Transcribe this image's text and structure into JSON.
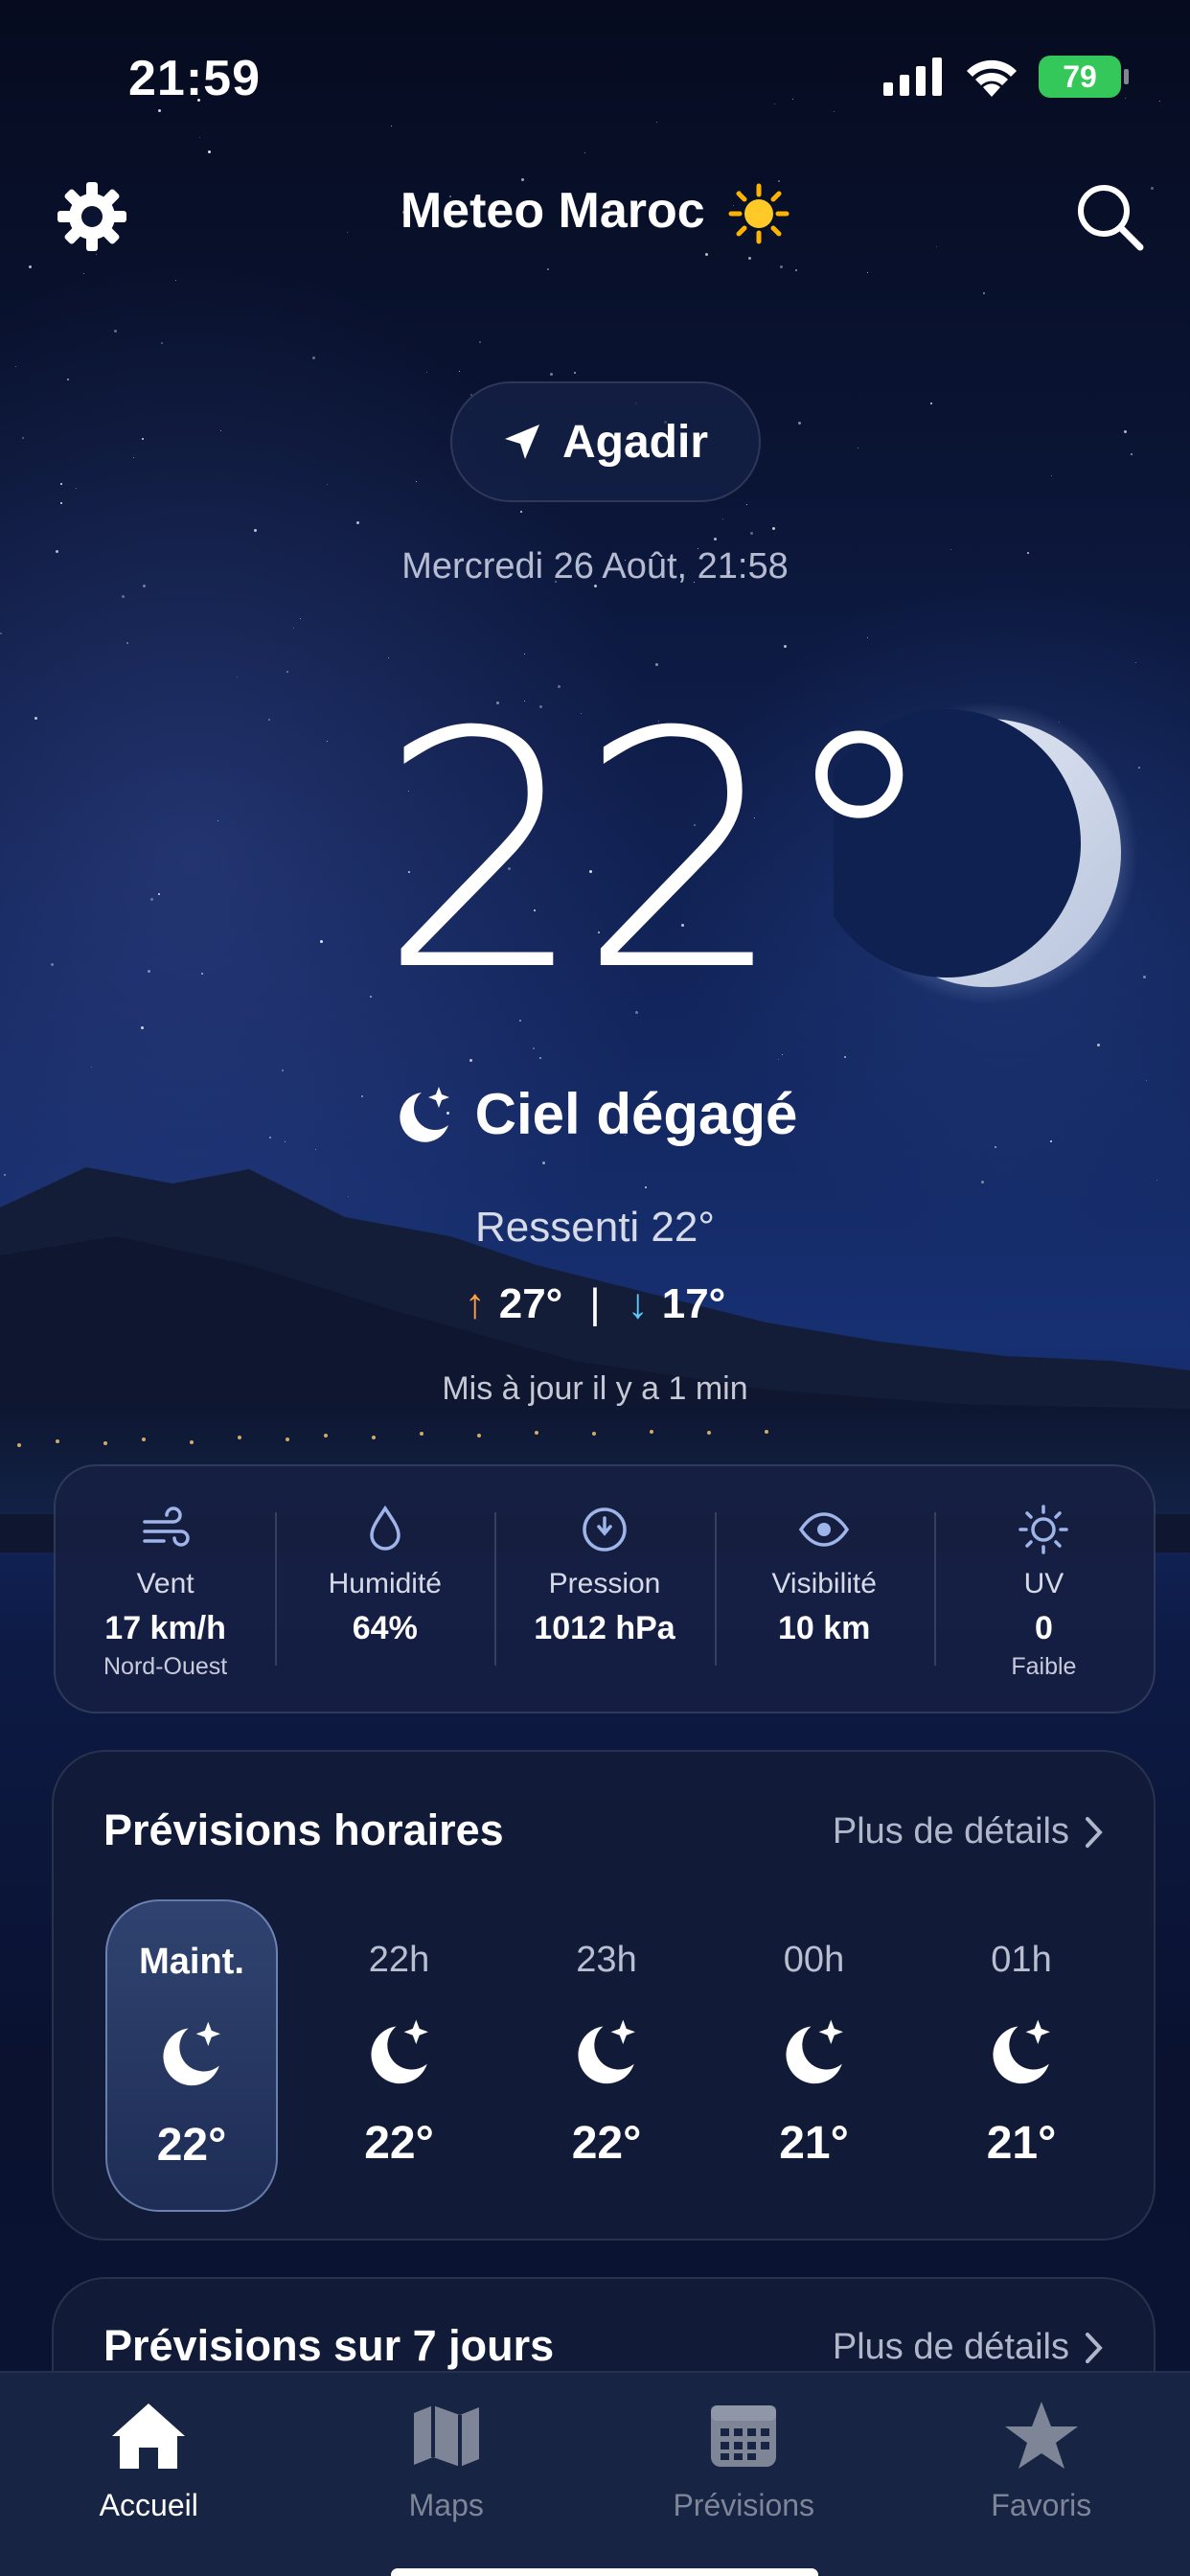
{
  "status_bar": {
    "time": "21:59",
    "battery": "79"
  },
  "header": {
    "title": "Meteo Maroc",
    "settings_icon": "gear-icon",
    "search_icon": "search-icon"
  },
  "location": {
    "city": "Agadir",
    "icon": "location-arrow-icon"
  },
  "current": {
    "date": "Mercredi 26 Août, 21:58",
    "temperature": "22°",
    "condition": "Ciel dégagé",
    "feels_like": "Ressenti 22°",
    "high": "27°",
    "low": "17°",
    "high_arrow": "↑",
    "low_arrow": "↓",
    "separator": "|",
    "updated": "Mis à jour il y a 1 min"
  },
  "metrics": [
    {
      "icon": "wind-icon",
      "label": "Vent",
      "value": "17 km/h",
      "sub": "Nord-Ouest"
    },
    {
      "icon": "humidity-drop-icon",
      "label": "Humidité",
      "value": "64%",
      "sub": ""
    },
    {
      "icon": "pressure-gauge-icon",
      "label": "Pression",
      "value": "1012 hPa",
      "sub": ""
    },
    {
      "icon": "eye-icon",
      "label": "Visibilité",
      "value": "10 km",
      "sub": ""
    },
    {
      "icon": "sun-uv-icon",
      "label": "UV",
      "value": "0",
      "sub": "Faible"
    }
  ],
  "hourly": {
    "title": "Prévisions horaires",
    "link": "Plus de détails",
    "hours": [
      {
        "label": "Maint.",
        "temp": "22°",
        "icon": "moon-stars-icon",
        "active": true
      },
      {
        "label": "22h",
        "temp": "22°",
        "icon": "moon-stars-icon",
        "active": false
      },
      {
        "label": "23h",
        "temp": "22°",
        "icon": "moon-stars-icon",
        "active": false
      },
      {
        "label": "00h",
        "temp": "21°",
        "icon": "moon-stars-icon",
        "active": false
      },
      {
        "label": "01h",
        "temp": "21°",
        "icon": "moon-stars-icon",
        "active": false
      }
    ]
  },
  "weekly": {
    "title": "Prévisions sur 7 jours",
    "link": "Plus de détails"
  },
  "tabbar": [
    {
      "label": "Accueil",
      "icon": "home-icon",
      "active": true
    },
    {
      "label": "Maps",
      "icon": "map-icon",
      "active": false
    },
    {
      "label": "Prévisions",
      "icon": "calendar-icon",
      "active": false
    },
    {
      "label": "Favoris",
      "icon": "star-icon",
      "active": false
    }
  ],
  "colors": {
    "accent_high": "#ff9f43",
    "accent_low": "#5ac8fa",
    "battery": "#34c759",
    "tabbar_bg": "#172444"
  }
}
